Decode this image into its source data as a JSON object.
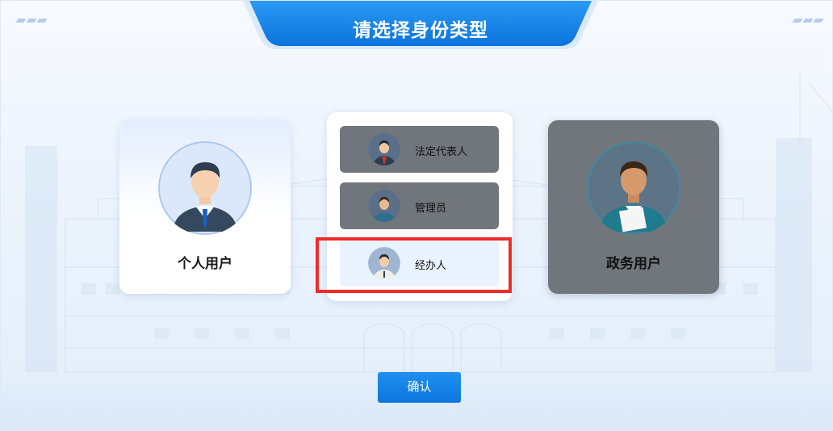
{
  "header": {
    "title": "请选择身份类型"
  },
  "identity_cards": {
    "personal": {
      "label": "个人用户",
      "avatar_icon": "businessman-avatar-icon"
    },
    "government": {
      "label": "政务用户",
      "avatar_icon": "official-avatar-icon"
    }
  },
  "roles": [
    {
      "label": "法定代表人",
      "icon": "legal-representative-avatar-icon",
      "selected": false
    },
    {
      "label": "管理员",
      "icon": "administrator-avatar-icon",
      "selected": false
    },
    {
      "label": "经办人",
      "icon": "handler-avatar-icon",
      "selected": true
    }
  ],
  "actions": {
    "confirm_label": "确认"
  },
  "colors": {
    "accent": "#1a84ea",
    "disabled_card": "#71767c",
    "selected_role_bg": "#e9f3fe",
    "highlight_border": "#ee2b2b"
  }
}
